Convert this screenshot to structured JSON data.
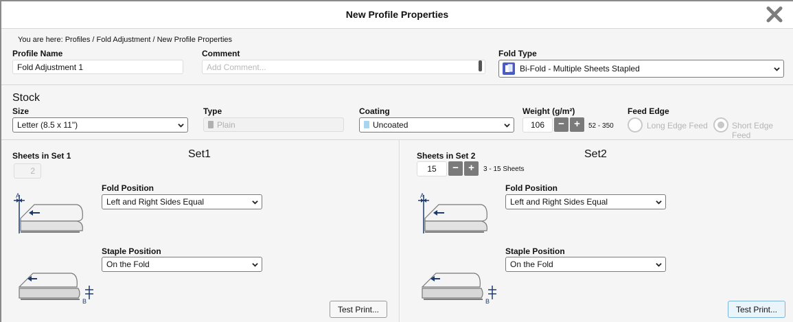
{
  "window": {
    "title": "New Profile Properties"
  },
  "breadcrumb": "You are here: Profiles / Fold Adjustment / New Profile Properties",
  "profile": {
    "name_label": "Profile Name",
    "name_value": "Fold Adjustment 1",
    "comment_label": "Comment",
    "comment_placeholder": "Add Comment...",
    "fold_type_label": "Fold Type",
    "fold_type_value": "Bi-Fold - Multiple Sheets Stapled"
  },
  "stock": {
    "title": "Stock",
    "size_label": "Size",
    "size_value": "Letter (8.5 x 11\")",
    "type_label": "Type",
    "type_value": "Plain",
    "coating_label": "Coating",
    "coating_value": "Uncoated",
    "weight_label": "Weight (g/m²)",
    "weight_value": "106",
    "weight_range": "52 - 350",
    "feed_edge_label": "Feed Edge",
    "feed_long": "Long Edge Feed",
    "feed_short": "Short Edge Feed"
  },
  "set1": {
    "title": "Set1",
    "sheets_label": "Sheets in Set 1",
    "sheets_value": "2",
    "fold_position_label": "Fold Position",
    "fold_position_value": "Left and Right Sides Equal",
    "staple_position_label": "Staple Position",
    "staple_position_value": "On the Fold",
    "test_print": "Test Print..."
  },
  "set2": {
    "title": "Set2",
    "sheets_label": "Sheets in Set 2",
    "sheets_value": "15",
    "sheets_range": "3 - 15 Sheets",
    "fold_position_label": "Fold Position",
    "fold_position_value": "Left and Right Sides Equal",
    "staple_position_label": "Staple Position",
    "staple_position_value": "On the Fold",
    "test_print": "Test Print..."
  },
  "diagram_labels": {
    "a": "A",
    "b": "B"
  },
  "stepper": {
    "minus": "−",
    "plus": "+"
  },
  "icons": {
    "close": "close-icon",
    "chevron": "chevron-down-icon",
    "fold_type": "bi-fold-stapled-icon",
    "fold_diagram": "fold-position-diagram-icon",
    "staple_diagram": "staple-position-diagram-icon"
  },
  "colors": {
    "panel_bg": "#f5f5f5",
    "stepper_bg": "#7a7a7a",
    "fold_type_icon_bg": "#4a5bc4",
    "coating_swatch": "#a8d4f0",
    "type_swatch": "#b0b0b0",
    "diagram_blue": "#1d3a6e"
  }
}
